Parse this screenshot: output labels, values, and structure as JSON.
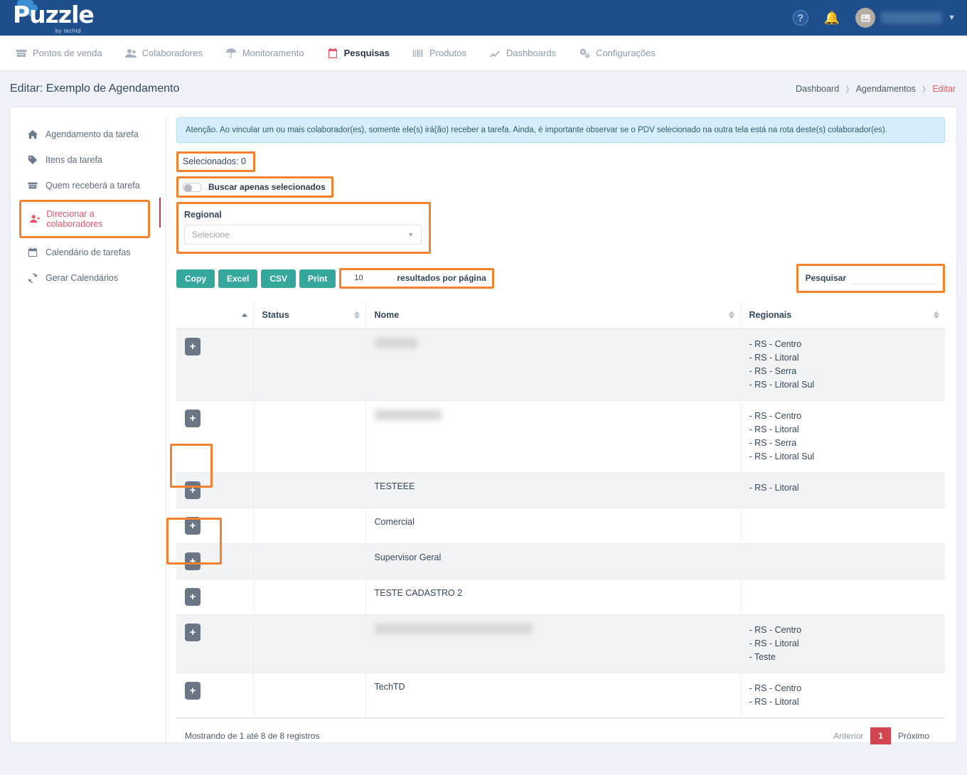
{
  "topbar": {
    "brand_name": "Puzzle",
    "brand_tagline": "by techtd",
    "help_icon": "question-circle-icon",
    "bell_icon": "bell-icon",
    "avatar_icon": "image-placeholder-icon",
    "caret_icon": "chevron-down-icon",
    "bg_color": "#1f4e8c"
  },
  "nav": {
    "items": [
      {
        "label": "Pontos de venda",
        "icon": "store-icon",
        "active": false
      },
      {
        "label": "Colaboradores",
        "icon": "users-icon",
        "active": false
      },
      {
        "label": "Monitoramento",
        "icon": "umbrella-icon",
        "active": false
      },
      {
        "label": "Pesquisas",
        "icon": "clipboard-icon",
        "active": true
      },
      {
        "label": "Produtos",
        "icon": "barcode-icon",
        "active": false
      },
      {
        "label": "Dashboards",
        "icon": "chart-line-icon",
        "active": false
      },
      {
        "label": "Configurações",
        "icon": "gears-icon",
        "active": false
      }
    ]
  },
  "page": {
    "title": "Editar: Exemplo de Agendamento",
    "breadcrumb": [
      {
        "label": "Dashboard",
        "current": false
      },
      {
        "label": "Agendamentos",
        "current": false
      },
      {
        "label": "Editar",
        "current": true
      }
    ]
  },
  "sidebar": {
    "items": [
      {
        "label": "Agendamento da tarefa",
        "icon": "home-icon",
        "active": false
      },
      {
        "label": "Itens da tarefa",
        "icon": "tag-icon",
        "active": false
      },
      {
        "label": "Quem receberá a tarefa",
        "icon": "store-icon",
        "active": false
      },
      {
        "label": "Direcionar a colaboradores",
        "icon": "user-plus-icon",
        "active": true
      },
      {
        "label": "Calendário de tarefas",
        "icon": "calendar-icon",
        "active": false
      },
      {
        "label": "Gerar Calendários",
        "icon": "refresh-icon",
        "active": false
      }
    ]
  },
  "content": {
    "alert": "Atenção. Ao vincular um ou mais colaborador(es), somente ele(s) irá(ão) receber a tarefa. Ainda, é importante observar se o PDV selecionado na outra tela está na rota deste(s) colaborador(es).",
    "selected_count_label": "Selecionados: 0",
    "toggle_label": "Buscar apenas selecionados",
    "toggle_on": false,
    "regional_label": "Regional",
    "regional_placeholder": "Selecione",
    "regional_value": "",
    "export_buttons": [
      "Copy",
      "Excel",
      "CSV",
      "Print"
    ],
    "per_page_value": "10",
    "per_page_label": "resultados por página",
    "search_label": "Pesquisar",
    "search_value": "",
    "search_placeholder": ""
  },
  "table": {
    "columns": [
      "",
      "Status",
      "Nome",
      "Regionais"
    ],
    "rows": [
      {
        "expand": "+",
        "status": "",
        "name": "",
        "name_blurred": true,
        "name_blur_width": 60,
        "regionais": [
          "- RS - Centro",
          "- RS - Litoral",
          "- RS - Serra",
          "- RS - Litoral Sul"
        ]
      },
      {
        "expand": "+",
        "status": "",
        "name": "",
        "name_blurred": true,
        "name_blur_width": 94,
        "regionais": [
          "- RS - Centro",
          "- RS - Litoral",
          "- RS - Serra",
          "- RS - Litoral Sul"
        ]
      },
      {
        "expand": "+",
        "status": "",
        "name": "TESTEEE",
        "name_blurred": false,
        "regionais": [
          "- RS - Litoral"
        ]
      },
      {
        "expand": "+",
        "status": "",
        "name": "Comercial",
        "name_blurred": false,
        "regionais": []
      },
      {
        "expand": "+",
        "status": "",
        "name": "Supervisor Geral",
        "name_blurred": false,
        "regionais": []
      },
      {
        "expand": "+",
        "status": "",
        "name": "TESTE CADASTRO 2",
        "name_blurred": false,
        "regionais": []
      },
      {
        "expand": "+",
        "status": "",
        "name": "",
        "name_blurred": true,
        "name_blur_width": 222,
        "regionais": [
          "- RS - Centro",
          "- RS - Litoral",
          "- Teste"
        ]
      },
      {
        "expand": "+",
        "status": "",
        "name": "TechTD",
        "name_blurred": false,
        "regionais": [
          "- RS - Centro",
          "- RS - Litoral"
        ]
      }
    ],
    "footer_info": "Mostrando de 1 até 8 de 8 registros",
    "pagination": {
      "prev": "Anterior",
      "current_page": "1",
      "next": "Próximo"
    }
  },
  "annotation_color": "#f28130"
}
